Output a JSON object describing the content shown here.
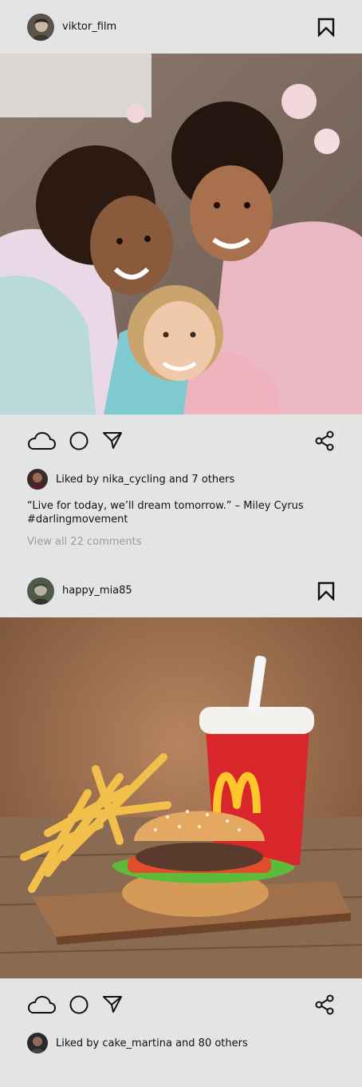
{
  "posts": [
    {
      "username": "viktor_film",
      "liked_by": "Liked by nika_cycling and 7 others",
      "caption": "“Live for today, we’ll dream tomorrow.” – Miley Cyrus",
      "hashtag": "#darlingmovement",
      "comments": "View all 22 comments",
      "image": "Three smiling children lying together under pink and colorful blankets"
    },
    {
      "username": "happy_mia85",
      "liked_by": "Liked by cake_martina and 80 others",
      "image": "Burger, french fries and a red McDonald's cup with a straw on a wooden board"
    }
  ],
  "icons": {
    "bookmark": "bookmark-icon",
    "like": "cloud-icon",
    "comment": "circle-icon",
    "send": "send-icon",
    "share": "share-icon"
  },
  "colors": {
    "background": "#e3e5e4",
    "text": "#111111",
    "muted": "#9a9a9a",
    "cup_red": "#d8262a",
    "logo_yellow": "#ffc72c"
  }
}
